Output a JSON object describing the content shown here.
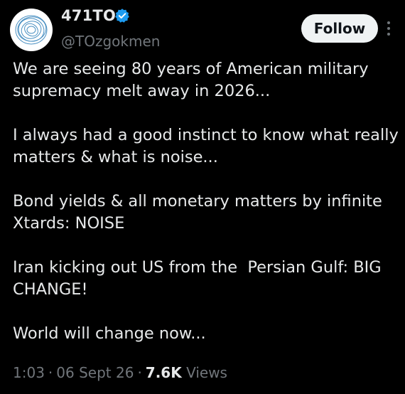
{
  "author": {
    "display_name": "471TO",
    "handle": "@TOzgokmen",
    "verified": true,
    "avatar": "circular-scribble-avatar"
  },
  "actions": {
    "follow_label": "Follow",
    "more_icon": "more-vertical-icon"
  },
  "tweet": {
    "text": "We are seeing 80 years of American military supremacy melt away in 2026...\n\nI always had a good instinct to know what really matters & what is noise...\n\nBond yields & all monetary matters by infinite Xtards: NOISE\n\nIran kicking out US from the  Persian Gulf: BIG CHANGE!\n\nWorld will change now..."
  },
  "meta": {
    "time": "1:03",
    "separator": "·",
    "date": "06 Sept 26",
    "views_count": "7.6K",
    "views_label": "Views"
  },
  "colors": {
    "background": "#000000",
    "text_primary": "#e7e9ea",
    "text_secondary": "#71767b",
    "verified_blue": "#1d9bf0",
    "follow_bg": "#eff3f4"
  }
}
